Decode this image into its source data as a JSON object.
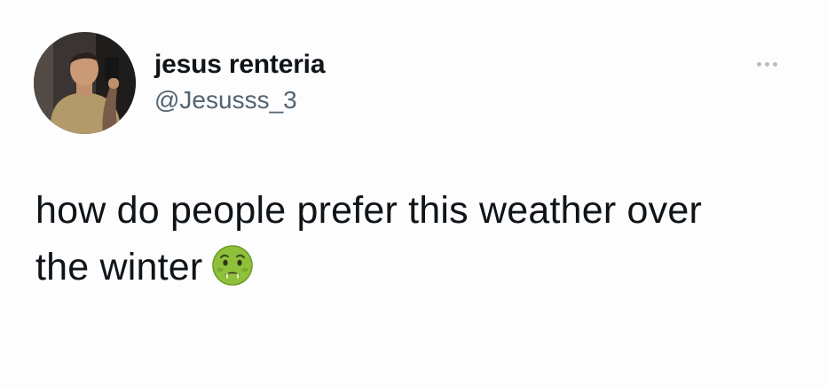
{
  "tweet": {
    "author": {
      "display_name": "jesus renteria",
      "handle": "@Jesusss_3",
      "avatar_icon": "profile-photo"
    },
    "menu_icon": "more-options-icon",
    "text": {
      "line1": "how do people prefer this weather over",
      "line2": "the winter"
    },
    "emoji_icon": "nauseated-face-emoji"
  },
  "colors": {
    "primary_text": "#0f1419",
    "secondary_text": "#536471",
    "menu_dots": "#b6bcc2",
    "emoji_face": "#8fc03a"
  }
}
